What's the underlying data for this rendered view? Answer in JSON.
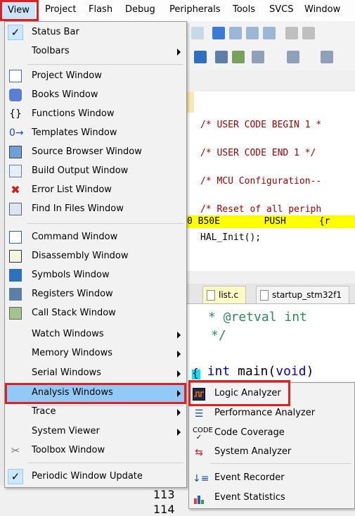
{
  "menubar": {
    "items": [
      "View",
      "Project",
      "Flash",
      "Debug",
      "Peripherals",
      "Tools",
      "SVCS",
      "Window"
    ]
  },
  "view_menu": {
    "items": [
      {
        "label": "Status Bar",
        "icon": "checkmark-icon",
        "checked": true
      },
      {
        "label": "Toolbars",
        "submenu": true
      },
      {
        "label": "Project Window",
        "icon": "project-window-icon"
      },
      {
        "label": "Books Window",
        "icon": "books-window-icon"
      },
      {
        "label": "Functions Window",
        "icon": "functions-window-icon",
        "glyph": "{}"
      },
      {
        "label": "Templates Window",
        "icon": "templates-window-icon",
        "glyph": "0→"
      },
      {
        "label": "Source Browser Window",
        "icon": "source-browser-icon"
      },
      {
        "label": "Build Output Window",
        "icon": "build-output-icon"
      },
      {
        "label": "Error List Window",
        "icon": "error-list-icon",
        "glyph": "✖"
      },
      {
        "label": "Find In Files Window",
        "icon": "find-in-files-icon"
      },
      {
        "label": "Command Window",
        "icon": "command-window-icon"
      },
      {
        "label": "Disassembly Window",
        "icon": "disassembly-window-icon"
      },
      {
        "label": "Symbols Window",
        "icon": "symbols-window-icon"
      },
      {
        "label": "Registers Window",
        "icon": "registers-window-icon"
      },
      {
        "label": "Call Stack Window",
        "icon": "call-stack-icon"
      },
      {
        "label": "Watch Windows",
        "submenu": true
      },
      {
        "label": "Memory Windows",
        "submenu": true
      },
      {
        "label": "Serial Windows",
        "submenu": true
      },
      {
        "label": "Analysis Windows",
        "submenu": true,
        "highlighted": true
      },
      {
        "label": "Trace",
        "submenu": true
      },
      {
        "label": "System Viewer",
        "submenu": true
      },
      {
        "label": "Toolbox Window",
        "icon": "toolbox-icon"
      },
      {
        "label": "Periodic Window Update",
        "icon": "checkmark-icon",
        "checked": true
      }
    ]
  },
  "analysis_submenu": {
    "items": [
      {
        "label": "Logic Analyzer",
        "icon": "logic-analyzer-icon"
      },
      {
        "label": "Performance Analyzer",
        "icon": "performance-analyzer-icon"
      },
      {
        "label": "Code Coverage",
        "icon": "code-coverage-icon"
      },
      {
        "label": "System Analyzer",
        "icon": "system-analyzer-icon"
      },
      {
        "label": "Event Recorder",
        "icon": "event-recorder-icon"
      },
      {
        "label": "Event Statistics",
        "icon": "event-statistics-icon"
      }
    ]
  },
  "editor": {
    "lines": [
      "/* USER CODE BEGIN 1 *",
      "/* USER CODE END 1 */",
      "/* MCU Configuration--",
      "/* Reset of all periph"
    ],
    "asm_line": "0 B50E        PUSH      {r",
    "hal_line": "HAL_Init();",
    "tabs": [
      "list.c",
      "startup_stm32f1"
    ],
    "code2_a": "* @retval int",
    "code2_b": "*/",
    "code2_c": "int main(void)",
    "code2_d": "{",
    "line_numbers": [
      "113",
      "114"
    ]
  },
  "colors": {
    "highlight_blue": "#91c9f7",
    "red_outline": "#e02020",
    "asm_yellow": "#ffff00",
    "comment_red": "#a00000"
  }
}
